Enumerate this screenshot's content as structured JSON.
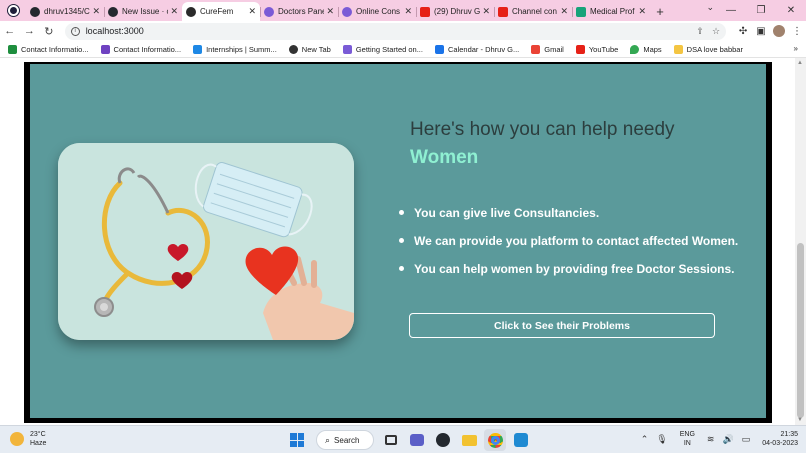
{
  "browser": {
    "tabs": [
      {
        "title": "dhruv1345/C",
        "color": "#24292f",
        "active": false
      },
      {
        "title": "New Issue · c",
        "color": "#24292f",
        "active": false
      },
      {
        "title": "CureFem",
        "color": "#2a2a2a",
        "active": true
      },
      {
        "title": "Doctors Pane",
        "color": "#7a5bd6",
        "active": false
      },
      {
        "title": "Online Cons",
        "color": "#7a5bd6",
        "active": false
      },
      {
        "title": "(29) Dhruv G",
        "color": "#e62117",
        "active": false
      },
      {
        "title": "Channel con",
        "color": "#e62117",
        "active": false
      },
      {
        "title": "Medical Prof",
        "color": "#18a37a",
        "active": false
      }
    ],
    "url": "localhost:3000",
    "bookmarks": [
      {
        "label": "Contact Informatio...",
        "color": "#1e8e3e"
      },
      {
        "label": "Contact Informatio...",
        "color": "#6f42c1"
      },
      {
        "label": "Internships | Summ...",
        "color": "#1e88e5"
      },
      {
        "label": "New Tab",
        "color": "#333333"
      },
      {
        "label": "Getting Started on...",
        "color": "#7a5bd6"
      },
      {
        "label": "Calendar - Dhruv G...",
        "color": "#1a73e8"
      },
      {
        "label": "Gmail",
        "color": "#ea4335"
      },
      {
        "label": "YouTube",
        "color": "#e62117"
      },
      {
        "label": "Maps",
        "color": "#34a853"
      },
      {
        "label": "DSA love babbar",
        "color": "#f4c542"
      }
    ]
  },
  "page": {
    "heading_prefix": "Here's how you can help needy ",
    "heading_accent": "Women",
    "points": [
      "You can give live Consultancies.",
      "We can provide you platform to contact affected Women.",
      "You can help women by providing free Doctor Sessions."
    ],
    "cta_label": "Click to See their Problems",
    "colors": {
      "panel": "#5b9a9b",
      "accent": "#8ff0d2",
      "heading": "#2c3e3e"
    }
  },
  "taskbar": {
    "temp": "23°C",
    "condition": "Haze",
    "search_label": "Search",
    "lang_1": "ENG",
    "lang_2": "IN",
    "time": "21:35",
    "date": "04-03-2023"
  }
}
